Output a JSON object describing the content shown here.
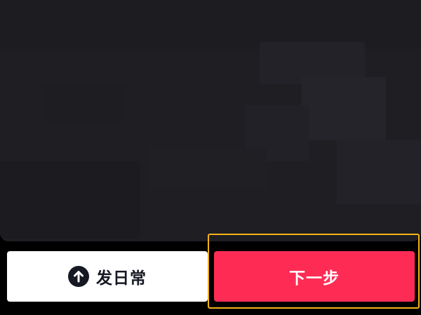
{
  "buttons": {
    "daily_label": "发日常",
    "daily_icon": "arrow-up-circle-icon",
    "next_label": "下一步"
  },
  "colors": {
    "preview_background": "#1f1e23",
    "daily_button_background": "#ffffff",
    "daily_button_text": "#161823",
    "next_button_background": "#fe2c55",
    "next_button_text": "#ffffff",
    "highlight_frame": "#f5b417"
  }
}
